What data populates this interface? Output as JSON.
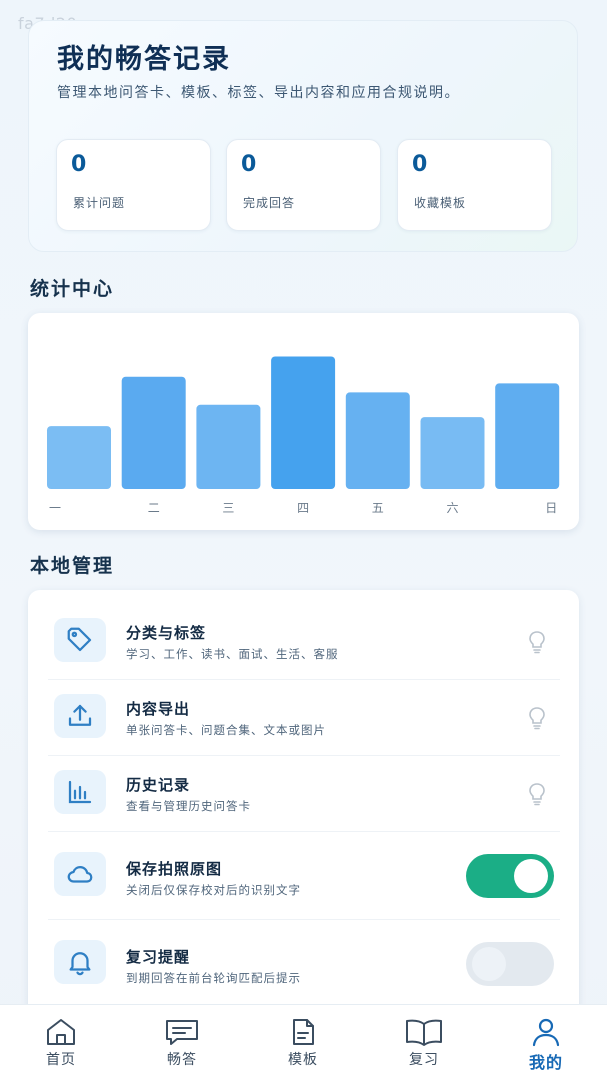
{
  "watermark": "fa7d20",
  "profile": {
    "title": "我的畅答记录",
    "subtitle": "管理本地问答卡、模板、标签、导出内容和应用合规说明。",
    "stats": [
      {
        "value": "0",
        "label": "累计问题"
      },
      {
        "value": "0",
        "label": "完成回答"
      },
      {
        "value": "0",
        "label": "收藏模板"
      }
    ]
  },
  "stats_section": {
    "title": "统计中心"
  },
  "chart_data": {
    "type": "bar",
    "categories": [
      "一",
      "二",
      "三",
      "四",
      "五",
      "六",
      "日"
    ],
    "values": [
      56,
      100,
      75,
      118,
      86,
      64,
      94
    ],
    "ylim": [
      0,
      130
    ],
    "grid": false,
    "bar_colors": [
      "#7bbdf3",
      "#5aaaf0",
      "#6db5f2",
      "#45a2ee",
      "#66b1f1",
      "#78bbf3",
      "#5fadf0"
    ],
    "title": "",
    "xlabel": "",
    "ylabel": ""
  },
  "manage_section": {
    "title": "本地管理",
    "rows": [
      {
        "icon": "tag-icon",
        "title": "分类与标签",
        "desc": "学习、工作、读书、面试、生活、客服",
        "trailing": "lightbulb"
      },
      {
        "icon": "upload-icon",
        "title": "内容导出",
        "desc": "单张问答卡、问题合集、文本或图片",
        "trailing": "lightbulb"
      },
      {
        "icon": "bar-chart-icon",
        "title": "历史记录",
        "desc": "查看与管理历史问答卡",
        "trailing": "lightbulb"
      },
      {
        "icon": "cloud-icon",
        "title": "保存拍照原图",
        "desc": "关闭后仅保存校对后的识别文字",
        "trailing": "toggle",
        "toggle_on": true
      },
      {
        "icon": "bell-icon",
        "title": "复习提醒",
        "desc": "到期回答在前台轮询匹配后提示",
        "trailing": "toggle",
        "toggle_on": false
      }
    ]
  },
  "nav": {
    "items": [
      {
        "label": "首页",
        "icon": "home-icon",
        "active": false
      },
      {
        "label": "畅答",
        "icon": "chat-icon",
        "active": false
      },
      {
        "label": "模板",
        "icon": "document-icon",
        "active": false
      },
      {
        "label": "复习",
        "icon": "book-icon",
        "active": false
      },
      {
        "label": "我的",
        "icon": "user-icon",
        "active": true
      }
    ]
  },
  "colors": {
    "accent": "#1769b5",
    "toggle_on": "#1bae86",
    "icon_stroke": "#2f7fc4"
  }
}
